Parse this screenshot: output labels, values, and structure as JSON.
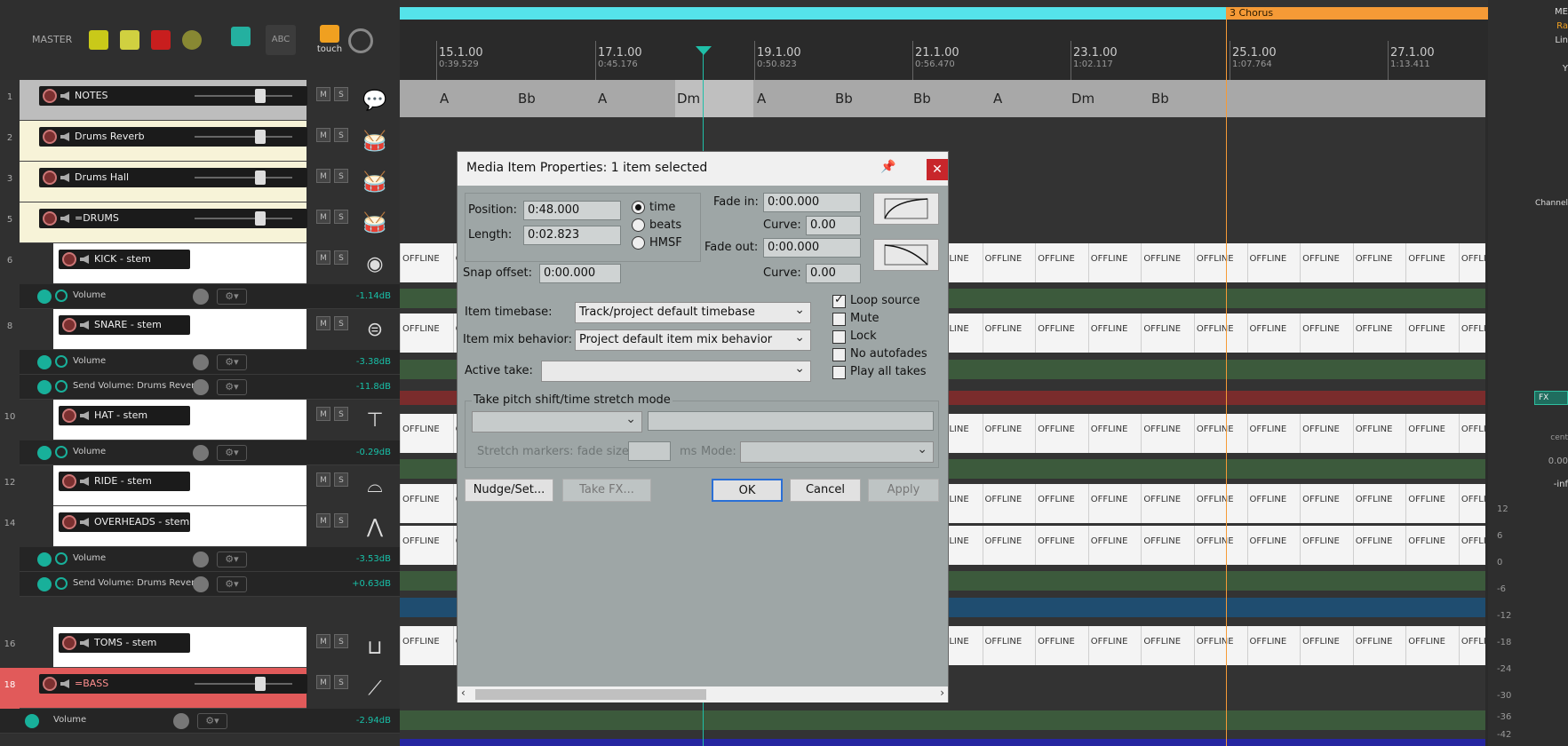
{
  "master": {
    "label": "MASTER",
    "abc_label": "ABC",
    "touch_label": "touch"
  },
  "colors": {
    "teal": "#1fbfa8",
    "cyan_region": "#55e3ea",
    "chorus_region": "#f59a36",
    "close_red": "#c8262b"
  },
  "tracks": [
    {
      "num": "1",
      "name": "NOTES",
      "icon": "speech-bubble-icon"
    },
    {
      "num": "2",
      "name": "Drums Reverb",
      "icon": "drumkit-icon"
    },
    {
      "num": "3",
      "name": "Drums Hall",
      "icon": "drumkit-icon"
    },
    {
      "num": "5",
      "name": "=DRUMS",
      "icon": "drumkit-icon"
    },
    {
      "num": "6",
      "name": "KICK - stem",
      "icon": "kick-drum-icon"
    },
    {
      "num": "8",
      "name": "SNARE - stem",
      "icon": "snare-icon"
    },
    {
      "num": "10",
      "name": "HAT - stem",
      "icon": "hihat-icon"
    },
    {
      "num": "12",
      "name": "RIDE - stem",
      "icon": "cymbal-icon"
    },
    {
      "num": "14",
      "name": "OVERHEADS - stem",
      "icon": "mic-stand-icon"
    },
    {
      "num": "16",
      "name": "TOMS - stem",
      "icon": "tom-icon"
    },
    {
      "num": "18",
      "name": "=BASS",
      "icon": "bass-guitar-icon"
    }
  ],
  "ms_labels": {
    "m": "M",
    "s": "S"
  },
  "envelopes": [
    {
      "label": "Volume",
      "value": "-1.14dB"
    },
    {
      "label": "Volume",
      "value": "-3.38dB"
    },
    {
      "label": "Send Volume: Drums Reverb",
      "value": "-11.8dB"
    },
    {
      "label": "Volume",
      "value": "-0.29dB"
    },
    {
      "label": "Volume",
      "value": "-3.53dB"
    },
    {
      "label": "Send Volume: Drums Reverb",
      "value": "+0.63dB"
    },
    {
      "label": "Volume",
      "value": "-2.94dB"
    }
  ],
  "region": {
    "chorus": "3   Chorus"
  },
  "ruler": [
    {
      "bar": "15.1.00",
      "time": "0:39.529"
    },
    {
      "bar": "17.1.00",
      "time": "0:45.176"
    },
    {
      "bar": "19.1.00",
      "time": "0:50.823"
    },
    {
      "bar": "21.1.00",
      "time": "0:56.470"
    },
    {
      "bar": "23.1.00",
      "time": "1:02.117"
    },
    {
      "bar": "25.1.00",
      "time": "1:07.764"
    },
    {
      "bar": "27.1.00",
      "time": "1:13.411"
    }
  ],
  "chords": [
    "A",
    "Bb",
    "A",
    "Dm",
    "A",
    "Bb",
    "Bb",
    "A",
    "Dm",
    "Bb"
  ],
  "offline_text": "OFFLINE",
  "dialog": {
    "title": "Media Item Properties:  1 item selected",
    "position_label": "Position:",
    "position_value": "0:48.000",
    "length_label": "Length:",
    "length_value": "0:02.823",
    "radio_time": "time",
    "radio_beats": "beats",
    "radio_hmsf": "HMSF",
    "fade_in_label": "Fade in:",
    "fade_in_value": "0:00.000",
    "curve_label": "Curve:",
    "curve_in_value": "0.00",
    "fade_out_label": "Fade out:",
    "fade_out_value": "0:00.000",
    "curve_out_value": "0.00",
    "snap_offset_label": "Snap offset:",
    "snap_offset_value": "0:00.000",
    "item_timebase_label": "Item timebase:",
    "item_timebase_value": "Track/project default timebase",
    "item_mix_label": "Item mix behavior:",
    "item_mix_value": "Project default item mix behavior",
    "active_take_label": "Active take:",
    "loop_source": "Loop source",
    "mute": "Mute",
    "lock": "Lock",
    "no_autofades": "No autofades",
    "play_all_takes": "Play all takes",
    "pitch_group_label": "Take pitch shift/time stretch mode",
    "stretch_markers_label": "Stretch markers: fade size:",
    "ms_label": "ms",
    "mode_label": "Mode:",
    "nudge_btn": "Nudge/Set...",
    "take_fx_btn": "Take FX...",
    "ok_btn": "OK",
    "cancel_btn": "Cancel",
    "apply_btn": "Apply"
  },
  "right_strip": {
    "labels": [
      "ME",
      "Ra",
      "Lin",
      "Y"
    ],
    "channel_label": "Channel",
    "fx_label": "FX",
    "center_label": "cent",
    "value": "0.00",
    "inf_label": "-inf",
    "scale": [
      "12",
      "6",
      "0",
      "-6",
      "-12",
      "-18",
      "-24",
      "-30",
      "-36",
      "-42"
    ]
  }
}
